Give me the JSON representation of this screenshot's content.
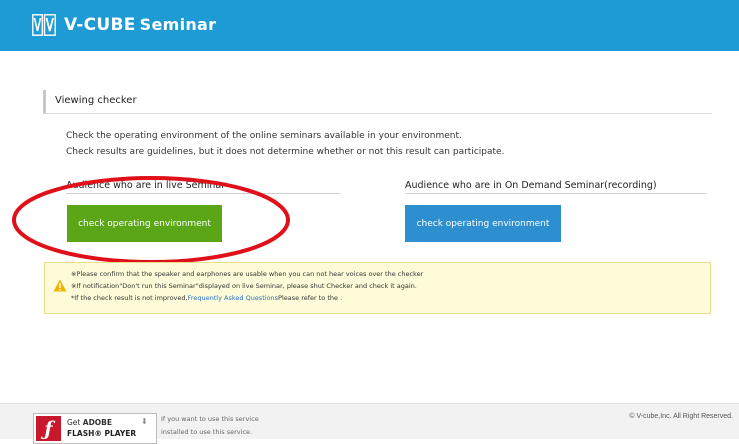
{
  "header": {
    "brand": "V-CUBE",
    "product": "Seminar",
    "background": "#1e9bd4"
  },
  "section": {
    "title": "Viewing checker"
  },
  "description": {
    "line1": "Check the operating environment of the online seminars available in your environment.",
    "line2": "Check results are guidelines, but it does not determine whether or not this result can participate."
  },
  "columns": {
    "live": {
      "title": "Audience who are in live Seminar",
      "button_label": "check operating environment",
      "button_color": "#5aa616"
    },
    "ondemand": {
      "title": "Audience who are in On Demand Seminar(recording)",
      "button_label": "check operating environment",
      "button_color": "#2d8fd0"
    }
  },
  "notice": {
    "line1": "※Please confirm that the speaker and earphones are usable when you can not hear voices over the checker",
    "line2": "※If notification\"Don't run this Seminar\"displayed on live Seminar, please shut Checker and check it again.",
    "line3_prefix": "*If the check result is not improved,",
    "line3_link": "Frequently Asked Questions",
    "line3_suffix": "Please refer to the ."
  },
  "footer": {
    "flash_get": "Get",
    "flash_adobe": "ADOBE",
    "flash_player": "FLASH® PLAYER",
    "note1": "If you want to use this service",
    "note2": "installed to use this service.",
    "copyright": "© V-cube,Inc. All Right Reserved."
  },
  "icons": {
    "logo": "v-cube-logo-icon",
    "warning": "warning-icon",
    "flash": "flash-player-icon",
    "download": "download-arrow-icon"
  },
  "annotation": {
    "color": "#e0101a"
  }
}
